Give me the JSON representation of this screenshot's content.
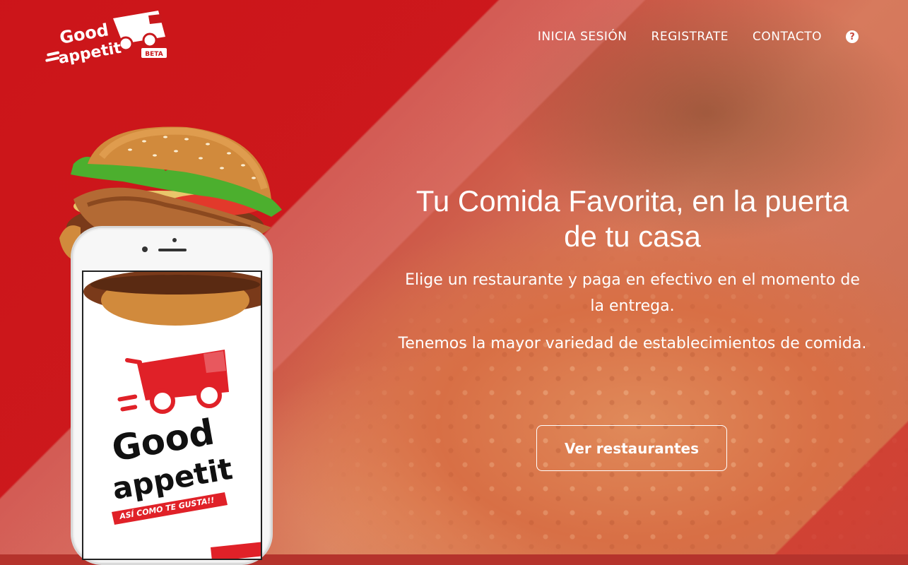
{
  "brand": {
    "logo_text_top": "Good",
    "logo_text_bottom": "appetit",
    "badge": "BETA",
    "accent": "#d1141b"
  },
  "nav": {
    "login": "INICIA SESIÓN",
    "register": "REGISTRATE",
    "contact": "CONTACTO",
    "help_icon": "question-circle-icon"
  },
  "hero": {
    "title": "Tu Comida Favorita, en la puerta de tu casa",
    "paragraph1": "Elige un restaurante y paga en efectivo en el momento de la entrega.",
    "paragraph2": "Tenemos la mayor variedad de establecimientos de comida.",
    "cta": "Ver restaurantes"
  },
  "phone_screen": {
    "logo_text_top": "Good",
    "logo_text_bottom": "appetit",
    "tagline": "ASÍ COMO TE GUSTA!!"
  }
}
